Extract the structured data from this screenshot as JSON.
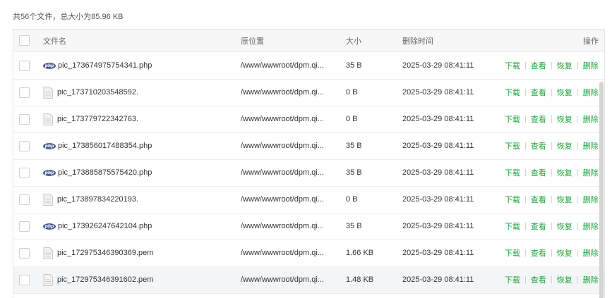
{
  "summary": "共56个文件，总大小为85.96 KB",
  "headers": {
    "name": "文件名",
    "path": "原位置",
    "size": "大小",
    "time": "删除时间",
    "ops": "操作"
  },
  "ops": {
    "download": "下载",
    "view": "查看",
    "restore": "恢复",
    "delete": "删除"
  },
  "accent": "#20a53a",
  "rows": [
    {
      "type": "php",
      "name": "pic_173674975754341.php",
      "path": "/www/wwwroot/dpm.qi...",
      "size": "35 B",
      "time": "2025-03-29 08:41:11"
    },
    {
      "type": "file",
      "name": "pic_173710203548592.",
      "path": "/www/wwwroot/dpm.qi...",
      "size": "0 B",
      "time": "2025-03-29 08:41:11"
    },
    {
      "type": "file",
      "name": "pic_173779722342763.",
      "path": "/www/wwwroot/dpm.qi...",
      "size": "0 B",
      "time": "2025-03-29 08:41:11"
    },
    {
      "type": "php",
      "name": "pic_173856017488354.php",
      "path": "/www/wwwroot/dpm.qi...",
      "size": "35 B",
      "time": "2025-03-29 08:41:11"
    },
    {
      "type": "php",
      "name": "pic_173885875575420.php",
      "path": "/www/wwwroot/dpm.qi...",
      "size": "35 B",
      "time": "2025-03-29 08:41:11"
    },
    {
      "type": "file",
      "name": "pic_173897834220193.",
      "path": "/www/wwwroot/dpm.qi...",
      "size": "0 B",
      "time": "2025-03-29 08:41:11"
    },
    {
      "type": "php",
      "name": "pic_173926247642104.php",
      "path": "/www/wwwroot/dpm.qi...",
      "size": "35 B",
      "time": "2025-03-29 08:41:11"
    },
    {
      "type": "file",
      "name": "pic_172975346390369.pem",
      "path": "/www/wwwroot/dpm.qi...",
      "size": "1.66 KB",
      "time": "2025-03-29 08:41:11"
    },
    {
      "type": "file",
      "name": "pic_172975346391602.pem",
      "path": "/www/wwwroot/dpm.qi...",
      "size": "1.48 KB",
      "time": "2025-03-29 08:41:11"
    }
  ]
}
